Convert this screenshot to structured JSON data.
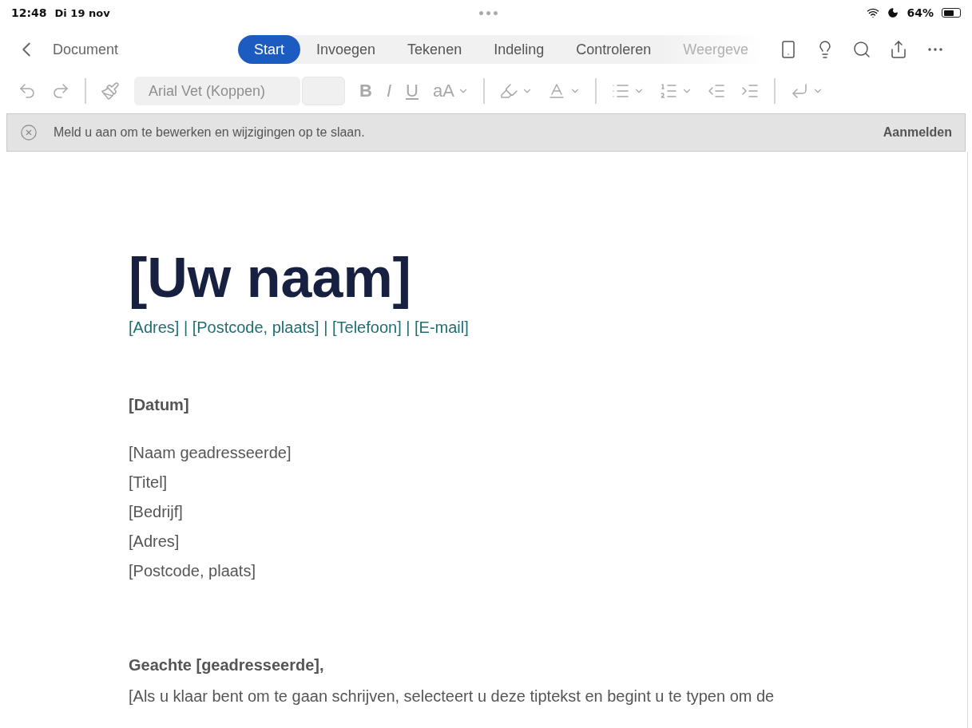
{
  "status_bar": {
    "time": "12:48",
    "date": "Di 19 nov",
    "battery": "64%"
  },
  "nav": {
    "back_label": "Document",
    "tabs": [
      {
        "label": "Start",
        "selected": true
      },
      {
        "label": "Invoegen",
        "selected": false
      },
      {
        "label": "Tekenen",
        "selected": false
      },
      {
        "label": "Indeling",
        "selected": false
      },
      {
        "label": "Controleren",
        "selected": false
      },
      {
        "label": "Weergeve",
        "selected": false
      }
    ]
  },
  "toolbar": {
    "disabled": true,
    "font": "Arial Vet (Koppen)",
    "bold": "B",
    "italic": "I",
    "underline": "U",
    "case": "aA"
  },
  "banner": {
    "message": "Meld u aan om te bewerken en wijzigingen op te slaan.",
    "action": "Aanmelden"
  },
  "document": {
    "name": "[Uw naam]",
    "contact": "[Adres] | [Postcode, plaats] | [Telefoon] | [E-mail]",
    "date": "[Datum]",
    "recipient": [
      "[Naam geadresseerde]",
      "[Titel]",
      "[Bedrijf]",
      "[Adres]",
      "[Postcode, plaats]"
    ],
    "salutation": "Geachte [geadresseerde],",
    "body": "[Als u klaar bent om te gaan schrijven, selecteert u deze tiptekst en begint u te typen om de"
  }
}
